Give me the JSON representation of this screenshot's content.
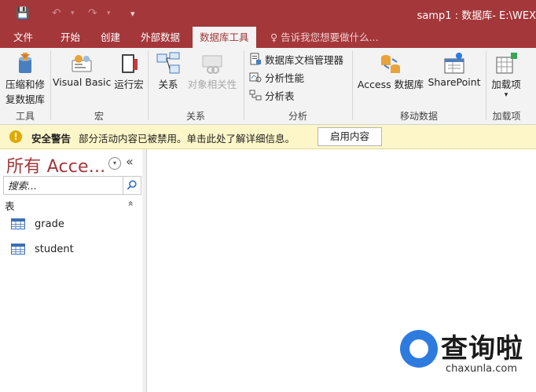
{
  "window": {
    "title": "samp1 : 数据库- E:\\WEX"
  },
  "qat": {
    "save": "💾",
    "undo": "↶",
    "redo": "↷",
    "more": "▾"
  },
  "tabs": [
    {
      "label": "文件"
    },
    {
      "label": "开始"
    },
    {
      "label": "创建"
    },
    {
      "label": "外部数据"
    },
    {
      "label": "数据库工具"
    }
  ],
  "tellme": {
    "icon": "lightbulb-icon",
    "text": "告诉我您想要做什么..."
  },
  "ribbon": {
    "groups": {
      "tools": {
        "label": "工具",
        "compact_label_1": "压缩和修",
        "compact_label_2": "复数据库"
      },
      "macro": {
        "label": "宏",
        "vb": "Visual Basic",
        "run": "运行宏"
      },
      "relations": {
        "label": "关系",
        "rel": "关系",
        "deps": "对象相关性"
      },
      "analyze": {
        "label": "分析",
        "documenter": "数据库文档管理器",
        "performance": "分析性能",
        "table": "分析表"
      },
      "move": {
        "label": "移动数据",
        "access": "Access 数据库",
        "sharepoint": "SharePoint"
      },
      "addins": {
        "label": "加载项",
        "btn": "加载项",
        "arrow": "▾"
      }
    }
  },
  "security": {
    "title": "安全警告",
    "message": "部分活动内容已被禁用。单击此处了解详细信息。",
    "button": "启用内容"
  },
  "nav": {
    "title": "所有 Acce...",
    "dropdown": "▾",
    "collapse": "«",
    "search_placeholder": "搜索...",
    "section": "表",
    "section_toggle": "«",
    "items": [
      {
        "label": "grade"
      },
      {
        "label": "student"
      }
    ]
  },
  "watermark": {
    "text": "查询啦",
    "sub": "chaxunla.com"
  }
}
